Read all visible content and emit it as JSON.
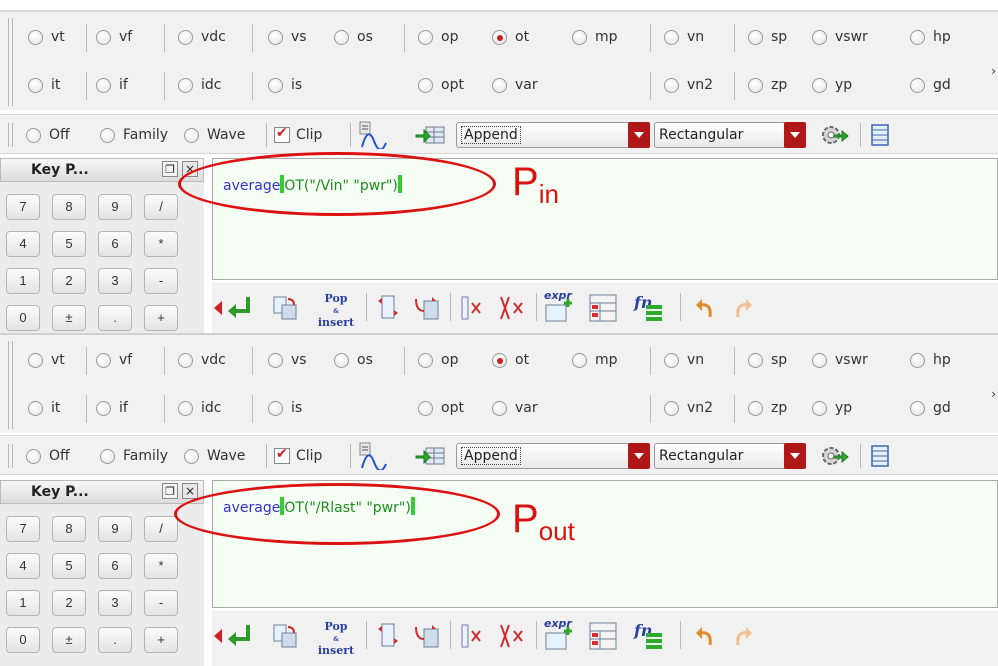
{
  "radio_row1": [
    {
      "label": "vt",
      "checked": false
    },
    {
      "label": "vf",
      "checked": false
    },
    {
      "label": "vdc",
      "checked": false
    },
    {
      "label": "vs",
      "checked": false
    },
    {
      "label": "os",
      "checked": false
    },
    {
      "label": "op",
      "checked": false
    },
    {
      "label": "ot",
      "checked": true
    },
    {
      "label": "mp",
      "checked": false
    },
    {
      "label": "vn",
      "checked": false
    },
    {
      "label": "sp",
      "checked": false
    },
    {
      "label": "vswr",
      "checked": false
    },
    {
      "label": "hp",
      "checked": false
    }
  ],
  "radio_row2": [
    {
      "label": "it",
      "checked": false
    },
    {
      "label": "if",
      "checked": false
    },
    {
      "label": "idc",
      "checked": false
    },
    {
      "label": "is",
      "checked": false
    },
    {
      "label": "opt",
      "checked": false
    },
    {
      "label": "var",
      "checked": false
    },
    {
      "label": "vn2",
      "checked": false
    },
    {
      "label": "zp",
      "checked": false
    },
    {
      "label": "yp",
      "checked": false
    },
    {
      "label": "gd",
      "checked": false
    }
  ],
  "toolbar": {
    "off_label": "Off",
    "family_label": "Family",
    "wave_label": "Wave",
    "clip_label": "Clip",
    "clip_checked": true,
    "append_value": "Append",
    "plot_type_value": "Rectangular"
  },
  "keypad": {
    "title": "Key P...",
    "keys": [
      "7",
      "8",
      "9",
      "/",
      "4",
      "5",
      "6",
      "*",
      "1",
      "2",
      "3",
      "-",
      "0",
      "±",
      ".",
      "+"
    ]
  },
  "panels": [
    {
      "expr_fn": "average",
      "expr_arg": "OT(\"/Vin\" \"pwr\")",
      "annotation_main": "P",
      "annotation_sub": "in"
    },
    {
      "expr_fn": "average",
      "expr_arg": "OT(\"/Rlast\" \"pwr\")",
      "annotation_main": "P",
      "annotation_sub": "out"
    }
  ],
  "bottom_toolbar": {
    "pop_insert_line1": "Pop",
    "pop_insert_line2": "insert",
    "expr_label": "expr",
    "fn_label": "fn"
  },
  "colors": {
    "radio_checked": "#cc1f1f",
    "annotation": "#dd1111",
    "expr_fn": "#3333cc",
    "expr_arg": "#1e8b1e",
    "cursor": "#33cc33",
    "dropdown_button": "#b01818"
  }
}
